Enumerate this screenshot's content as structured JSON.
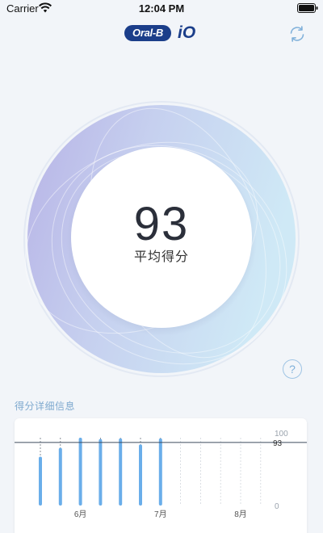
{
  "status_bar": {
    "carrier": "Carrier",
    "time": "12:04 PM"
  },
  "header": {
    "brand": "Oral-B",
    "model": "iO"
  },
  "score": {
    "value": "93",
    "label": "平均得分"
  },
  "details": {
    "title": "得分详细信息"
  },
  "colors": {
    "accent": "#2f7fd8",
    "bar": "#6aaeea",
    "brand": "#1b3e8a",
    "section_title": "#7ea9cf"
  },
  "chart_data": {
    "type": "bar",
    "y_axis_labels": [
      "100",
      "0"
    ],
    "ylim": [
      0,
      100
    ],
    "average_line": 93,
    "average_label": "93",
    "x_labels": [
      {
        "label": "6月",
        "index": 2
      },
      {
        "label": "7月",
        "index": 6
      },
      {
        "label": "8月",
        "index": 10
      }
    ],
    "slots": 12,
    "values": [
      72,
      85,
      100,
      98,
      99,
      90,
      99
    ]
  }
}
